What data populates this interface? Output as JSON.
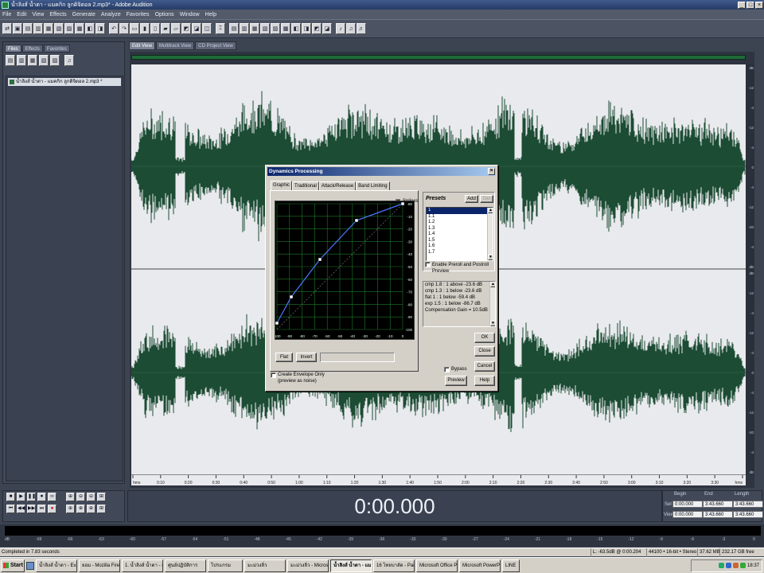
{
  "window": {
    "title": "น้ำลิงส์ น้ำตา - แมคกิก ลูกดิจิตอล 2.mp3* - Adobe Audition",
    "minimize": "_",
    "restore": "□",
    "close": "×"
  },
  "menu": [
    "File",
    "Edit",
    "View",
    "Effects",
    "Generate",
    "Analyze",
    "Favorites",
    "Options",
    "Window",
    "Help"
  ],
  "left_panel": {
    "tabs": [
      "Files",
      "Effects",
      "Favorites"
    ],
    "file_item": "น้ำลิงส์ น้ำตา - แมคกิก ลูกดิจิตอล 2.mp3 *"
  },
  "main_tabs": [
    "Edit View",
    "Multitrack View",
    "CD Project View"
  ],
  "db_ruler_top": [
    "dB",
    "-12",
    "-4",
    "-12",
    "-4",
    "0",
    "-4",
    "-12",
    "-20",
    "-4",
    "dB"
  ],
  "db_ruler_bottom": [
    "dB",
    "-12",
    "-4",
    "-12",
    "-4",
    "0",
    "-4",
    "-12",
    "-20",
    "-4",
    "dB"
  ],
  "timeline_labels": [
    "hms",
    "0:10",
    "0:20",
    "0:30",
    "0:40",
    "0:50",
    "1:00",
    "1:10",
    "1:20",
    "1:30",
    "1:40",
    "1:50",
    "2:00",
    "2:10",
    "2:20",
    "2:30",
    "2:40",
    "2:50",
    "3:00",
    "3:10",
    "3:20",
    "3:30",
    "hms"
  ],
  "transport": {
    "row1": [
      "■",
      "▶",
      "❚❚",
      "⏺",
      "∞"
    ],
    "row2": [
      "⏮",
      "◀◀",
      "▶▶",
      "⏭",
      "●"
    ],
    "zoom_row1": [
      "⊕",
      "⊖",
      "⊖",
      "⊞"
    ],
    "zoom_row2": [
      "⊕",
      "⊕",
      "⊕",
      "⊞"
    ]
  },
  "time_display": "0:00.000",
  "selection": {
    "headers": [
      "Begin",
      "End",
      "Length"
    ],
    "rows": [
      {
        "label": "Sel",
        "values": [
          "0:00.000",
          "3:43.660",
          "3:43.660"
        ]
      },
      {
        "label": "View",
        "values": [
          "0:00.000",
          "3:43.660",
          "3:43.660"
        ]
      }
    ]
  },
  "level_meter_scale": [
    "dB",
    "-69",
    "-66",
    "-63",
    "-60",
    "-57",
    "-54",
    "-51",
    "-48",
    "-45",
    "-42",
    "-39",
    "-36",
    "-33",
    "-30",
    "-27",
    "-24",
    "-21",
    "-18",
    "-15",
    "-12",
    "-9",
    "-6",
    "-3",
    "0"
  ],
  "status_bar": {
    "message": "Completed in 7.83 seconds",
    "cells": [
      "L: -63.5dB @ 0:00.204",
      "44100 • 16-bit • Stereo",
      "37.62 MB",
      "232.17 GB free"
    ]
  },
  "taskbar": {
    "start": "Start",
    "tasks": [
      "น้ำลิงส์ น้ำตา - Ev...",
      "ยอม - Mozilla Firefox",
      "1. น้ำลิงส์ น้ำตา - ยอ...",
      "ศูนย์ปฏิบัติการ",
      "โปรแกรม",
      "มะม่วงลิ่ว",
      "มะม่วงลิ่ว - Microsoft...",
      "น้ำลิงส์ น้ำตา - แมค...",
      "16 ไทยบาลัด - Paint",
      "Microsoft Office Pic...",
      "Microsoft PowerPoi...",
      "LINE"
    ],
    "active_index": 7,
    "clock": "18:37"
  },
  "dialog": {
    "title": "Dynamics Processing",
    "tabs": [
      "Graphic",
      "Traditional",
      "Attack/Release",
      "Band Limiting"
    ],
    "splines_label": "Splines",
    "graph_right_ticks": [
      "-80",
      "-10",
      "-20",
      "-30",
      "-40",
      "-50",
      "-60",
      "-70",
      "-80",
      "-90",
      "-100"
    ],
    "graph_bottom_ticks": [
      "-100",
      "-90",
      "-80",
      "-70",
      "-60",
      "-50",
      "-40",
      "-30",
      "-20",
      "-10",
      "0"
    ],
    "flat_button": "Flat",
    "invert_button": "Invert",
    "envelope_label": "Create Envelope Only",
    "envelope_sub": "(preview as noise)",
    "presets_label": "Presets",
    "add_button": "Add",
    "del_button": "Del",
    "preset_items": [
      "1",
      "1.1",
      "1.2",
      "1.3",
      "1.4",
      "1.5",
      "1.6",
      "1.7"
    ],
    "selected_preset_index": 0,
    "preroll_label": "Enable Preroll and Postroll Preview",
    "summary_lines": [
      "cmp   1.8 : 1     above  -23.6 dB",
      "cmp   1.3 : 1     below  -23.6 dB",
      "flat    1 : 1     below  -59.4 dB",
      "exp   1.5 : 1     below  -86.7 dB",
      "Compensation Gain = 10.5dB"
    ],
    "ok_button": "OK",
    "close_button": "Close",
    "cancel_button": "Cancel",
    "bypass_label": "Bypass",
    "preview_button": "Preview",
    "help_button": "Help"
  }
}
